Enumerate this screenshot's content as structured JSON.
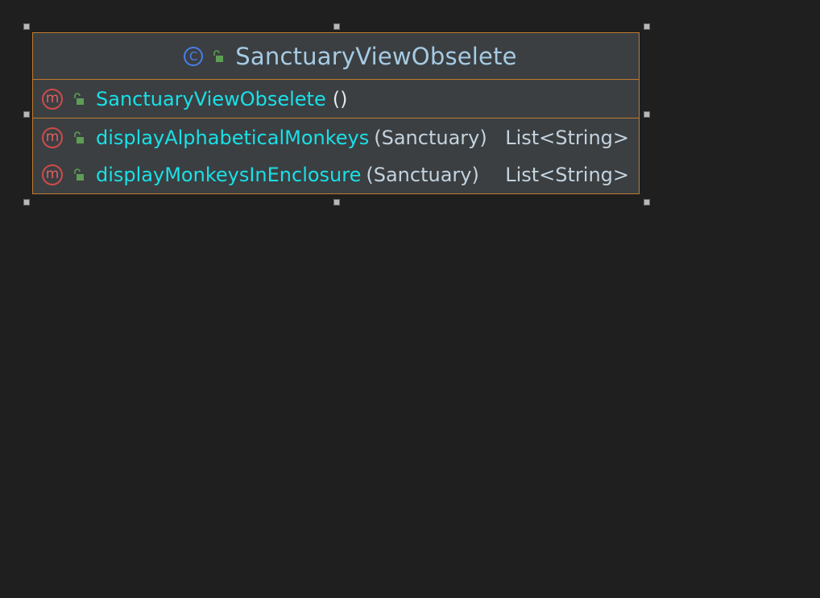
{
  "class": {
    "icon_letter": "C",
    "name": "SanctuaryViewObselete"
  },
  "constructor": {
    "icon_letter": "m",
    "name": "SanctuaryViewObselete",
    "params": "()"
  },
  "methods": [
    {
      "icon_letter": "m",
      "name": "displayAlphabeticalMonkeys",
      "params": "(Sanctuary)",
      "return_type": "List<String>"
    },
    {
      "icon_letter": "m",
      "name": "displayMonkeysInEnclosure",
      "params": "(Sanctuary)",
      "return_type": "List<String>"
    }
  ],
  "colors": {
    "canvas": "#1f1f1f",
    "box_fill": "#3b3f42",
    "box_border": "#c07a2e",
    "class_icon": "#4a7dea",
    "method_icon": "#cf4b4b",
    "lock": "#5d9e54",
    "method_name": "#19e0e6",
    "type_text": "#c4d3de"
  },
  "icons": {
    "class": "class-icon",
    "method": "method-icon",
    "visibility": "public-lock-icon"
  }
}
